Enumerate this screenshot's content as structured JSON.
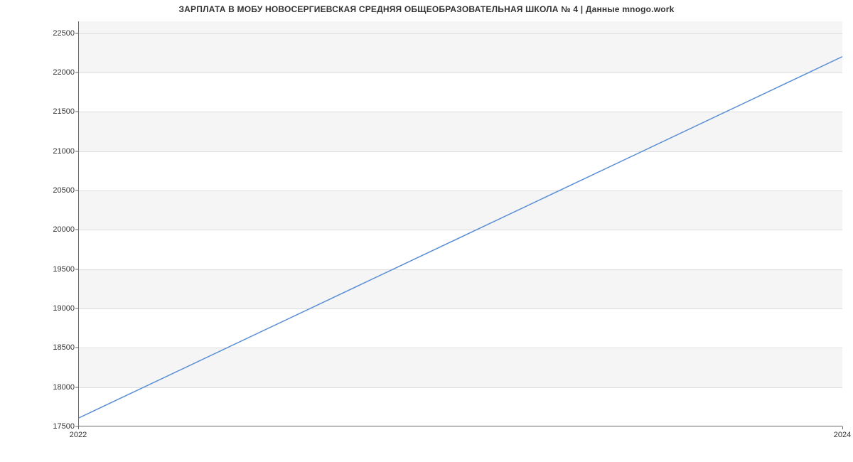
{
  "chart_data": {
    "type": "line",
    "title": "ЗАРПЛАТА В МОБУ НОВОСЕРГИЕВСКАЯ СРЕДНЯЯ ОБЩЕОБРАЗОВАТЕЛЬНАЯ ШКОЛА № 4 | Данные mnogo.work",
    "xlabel": "",
    "ylabel": "",
    "x": [
      2022,
      2024
    ],
    "values": [
      17600,
      22200
    ],
    "x_ticks": [
      2022,
      2024
    ],
    "y_ticks": [
      17500,
      18000,
      18500,
      19000,
      19500,
      20000,
      20500,
      21000,
      21500,
      22000,
      22500
    ],
    "xlim": [
      2022,
      2024
    ],
    "ylim": [
      17500,
      22650
    ],
    "grid": true,
    "line_color": "#5b8fd6"
  }
}
